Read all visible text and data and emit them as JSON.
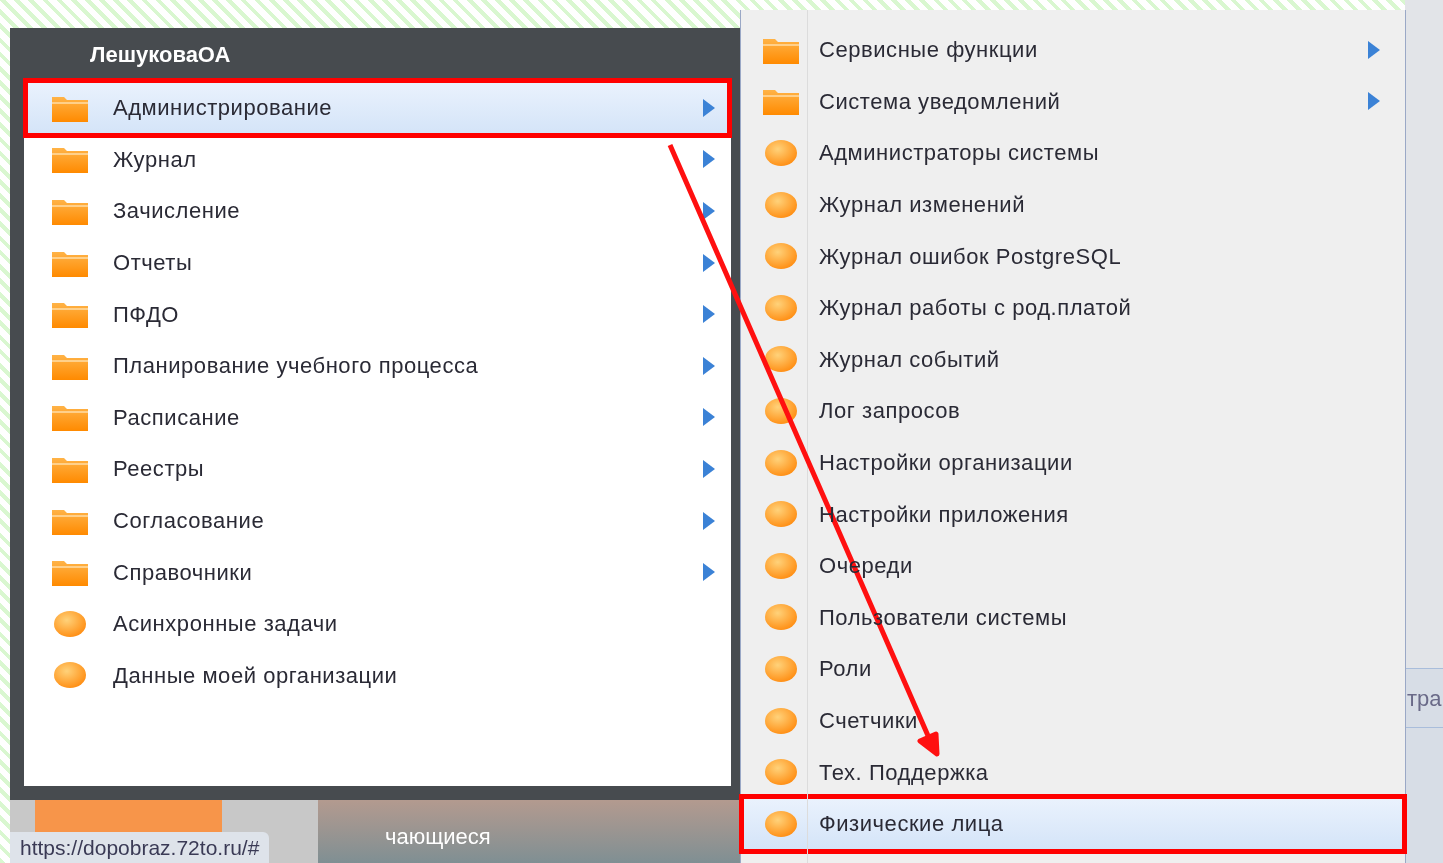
{
  "user_menu": {
    "title": "ЛешуковаОА",
    "items": [
      {
        "label": "Администрирование",
        "kind": "folder",
        "selected": true
      },
      {
        "label": "Журнал",
        "kind": "folder",
        "selected": false
      },
      {
        "label": "Зачисление",
        "kind": "folder",
        "selected": false
      },
      {
        "label": "Отчеты",
        "kind": "folder",
        "selected": false
      },
      {
        "label": "ПФДО",
        "kind": "folder",
        "selected": false
      },
      {
        "label": "Планирование учебного процесса",
        "kind": "folder",
        "selected": false
      },
      {
        "label": "Расписание",
        "kind": "folder",
        "selected": false
      },
      {
        "label": "Реестры",
        "kind": "folder",
        "selected": false
      },
      {
        "label": "Согласование",
        "kind": "folder",
        "selected": false
      },
      {
        "label": "Справочники",
        "kind": "folder",
        "selected": false
      },
      {
        "label": "Асинхронные задачи",
        "kind": "leaf",
        "selected": false
      },
      {
        "label": "Данные моей организации",
        "kind": "leaf",
        "selected": false
      }
    ]
  },
  "submenu": {
    "items": [
      {
        "label": "Сервисные функции",
        "kind": "folder",
        "selected": false
      },
      {
        "label": "Система уведомлений",
        "kind": "folder",
        "selected": false
      },
      {
        "label": "Администраторы системы",
        "kind": "leaf",
        "selected": false
      },
      {
        "label": "Журнал изменений",
        "kind": "leaf",
        "selected": false
      },
      {
        "label": "Журнал ошибок PostgreSQL",
        "kind": "leaf",
        "selected": false
      },
      {
        "label": "Журнал работы с род.платой",
        "kind": "leaf",
        "selected": false
      },
      {
        "label": "Журнал событий",
        "kind": "leaf",
        "selected": false
      },
      {
        "label": "Лог запросов",
        "kind": "leaf",
        "selected": false
      },
      {
        "label": "Настройки организации",
        "kind": "leaf",
        "selected": false
      },
      {
        "label": "Настройки приложения",
        "kind": "leaf",
        "selected": false
      },
      {
        "label": "Очереди",
        "kind": "leaf",
        "selected": false
      },
      {
        "label": "Пользователи системы",
        "kind": "leaf",
        "selected": false
      },
      {
        "label": "Роли",
        "kind": "leaf",
        "selected": false
      },
      {
        "label": "Счетчики",
        "kind": "leaf",
        "selected": false
      },
      {
        "label": "Тех. Поддержка",
        "kind": "leaf",
        "selected": false
      },
      {
        "label": "Физические лица",
        "kind": "leaf",
        "selected": true
      }
    ]
  },
  "taskbar": {
    "tab_label": "чающиеся"
  },
  "side_fragment": {
    "text": "тра"
  },
  "status_url": "https://dopobraz.72to.ru/#"
}
